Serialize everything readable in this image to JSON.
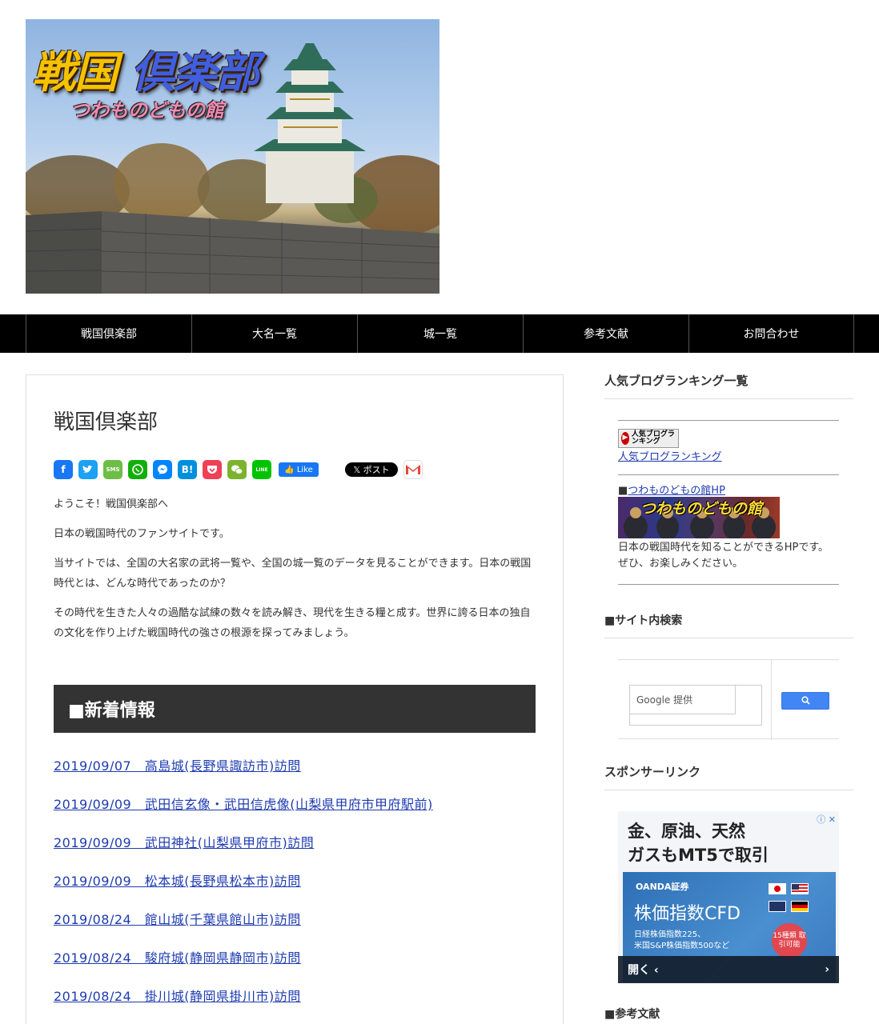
{
  "header": {
    "logo_part1": "戦国",
    "logo_part2": "倶楽部",
    "logo_sub": "つわものどもの館"
  },
  "nav": {
    "items": [
      "戦国倶楽部",
      "大名一覧",
      "城一覧",
      "参考文献",
      "お問合わせ"
    ]
  },
  "main": {
    "title": "戦国倶楽部",
    "share": {
      "line_label": "LINE",
      "hatena_label": "B!",
      "sms_label": "SMS",
      "like_label": "Like",
      "post_label": "ポスト"
    },
    "paragraphs": [
      "ようこそ！戦国倶楽部へ",
      "日本の戦国時代のファンサイトです。",
      "当サイトでは、全国の大名家の武将一覧や、全国の城一覧のデータを見ることができます。日本の戦国時代とは、どんな時代であったのか？",
      "その時代を生きた人々の過酷な試練の数々を読み解き、現代を生きる糧と成す。世界に誇る日本の独自の文化を作り上げた戦国時代の強さの根源を探ってみましょう。"
    ],
    "news_heading": "■新着情報",
    "news": [
      "2019/09/07　高島城(長野県諏訪市)訪問",
      "2019/09/09　武田信玄像・武田信虎像(山梨県甲府市甲府駅前)",
      "2019/09/09　武田神社(山梨県甲府市)訪問",
      "2019/09/09　松本城(長野県松本市)訪問",
      "2019/08/24　館山城(千葉県館山市)訪問",
      "2019/08/24　駿府城(静岡県静岡市)訪問",
      "2019/08/24　掛川城(静岡県掛川市)訪問"
    ]
  },
  "sidebar": {
    "ranking_heading": "人気ブログランキング一覧",
    "ranking_badge": "人気ブログランキング",
    "ranking_link": "人気ブログランキング",
    "hp_prefix": "■",
    "hp_link": "つわものどもの館HP",
    "hp_banner_text": "つわものどもの館",
    "hp_desc": "日本の戦国時代を知ることができるHPです。ぜひ、お楽しみください。",
    "search_heading": "■サイト内検索",
    "search_placeholder": "Google 提供",
    "sponsor_heading": "スポンサーリンク",
    "ad": {
      "headline_1": "金、原油、天然",
      "headline_2": "ガスもMT5で取引",
      "brand": "OANDA証券",
      "title": "株価指数CFD",
      "sub_1": "日経株価指数225、",
      "sub_2": "米国S&P株価指数500など",
      "bubble": "15種類 取引可能",
      "open": "開く",
      "info_close": "ⓘ ✕"
    },
    "refs_heading": "■参考文献"
  }
}
